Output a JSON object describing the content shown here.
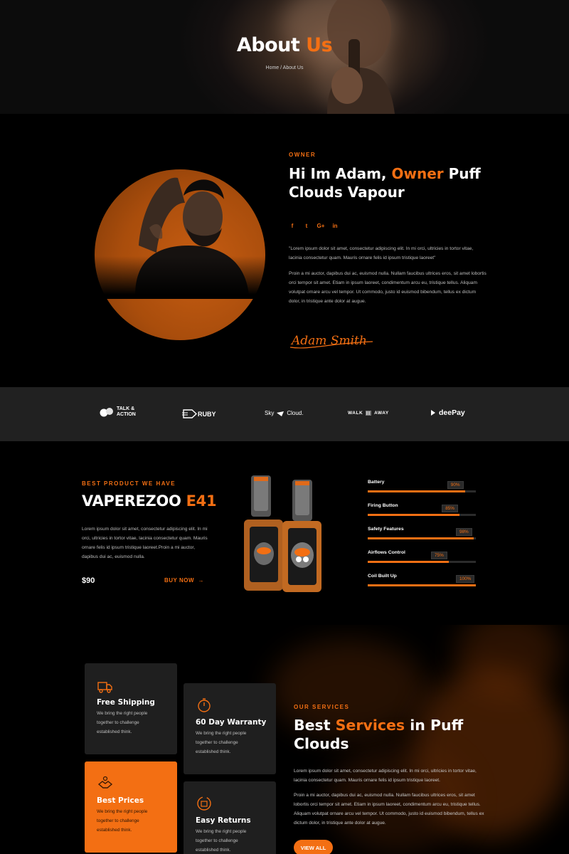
{
  "colors": {
    "accent": "#f36f13",
    "background": "#000000",
    "brand_bar": "#212121",
    "card": "#1f1f1f"
  },
  "hero": {
    "title_white": "About",
    "title_orange": "Us",
    "breadcrumb": "Home / About Us"
  },
  "owner": {
    "label": "OWNER",
    "title_part1": "Hi Im Adam,",
    "title_orange": "Owner",
    "title_part2": "Puff Clouds Vapour",
    "socials": [
      {
        "icon": "facebook-icon",
        "glyph": "f"
      },
      {
        "icon": "twitter-icon",
        "glyph": "t"
      },
      {
        "icon": "google-plus-icon",
        "glyph": "G+"
      },
      {
        "icon": "linkedin-icon",
        "glyph": "in"
      }
    ],
    "quote": "\"Lorem ipsum dolor sit amet, consectetur adipiscing elit. In mi orci, ultricies in tortor vitae, lacinia consectetur quam. Mauris ornare felis id ipsum tristique laoreet\"",
    "body": "Proin a mi auctor, dapibus dui ac, euismod nulla. Nullam faucibus ultrices eros, sit amet lobortis orci tempor sit amet. Etiam in ipsum laoreet, condimentum arcu eu, tristique tellus. Aliquam volutpat ornare arcu vel tempor. Ut commodo, justo id euismod bibendum, tellus ex dictum dolor, in tristique ante dolor at augue.",
    "signature": "Adam Smith"
  },
  "brands": [
    {
      "name": "TALK & ACTION",
      "line1": "TALK &",
      "line2": "ACTION"
    },
    {
      "name": "RUBY"
    },
    {
      "name": "Sky Cloud.",
      "left": "Sky",
      "right": "Cloud."
    },
    {
      "name": "WALK AWAY",
      "left": "WALK",
      "right": "AWAY"
    },
    {
      "name": "deePay"
    }
  ],
  "product": {
    "label": "BEST PRODUCT WE HAVE",
    "title_white": "VAPEREZOO",
    "title_orange": "E41",
    "body": "Lorem ipsum dolor sit amet, consectetur adipiscing elit. In mi orci, ultricies in tortor vitae, lacinia consectetur quam. Mauris ornare felis id ipsum tristique laoreet.Proin a mi auctor, dapibus dui ac, euismod nulla.",
    "price": "$90",
    "buy_label": "BUY NOW",
    "skills": [
      {
        "name": "Battery",
        "percent": 90,
        "label": "90%"
      },
      {
        "name": "Firing Button",
        "percent": 85,
        "label": "85%"
      },
      {
        "name": "Safety Features",
        "percent": 98,
        "label": "98%"
      },
      {
        "name": "Airflows Control",
        "percent": 75,
        "label": "75%"
      },
      {
        "name": "Coil Built Up",
        "percent": 100,
        "label": "100%"
      }
    ]
  },
  "services": {
    "label": "OUR SERVICES",
    "title_part1": "Best",
    "title_orange": "Services",
    "title_part2": "in Puff Clouds",
    "body1": "Lorem ipsum dolor sit amet, consectetur adipiscing elit. In mi orci, ultricies in tortor vitae, lacinia consectetur quam. Mauris ornare felis id ipsum tristique laoreet.",
    "body2": "Proin a mi auctor, dapibus dui ac, euismod nulla. Nullam faucibus ultrices eros, sit amet lobortis orci tempor sit amet. Etiam in ipsum laoreet, condimentum arcu eu, tristique tellus. Aliquam volutpat ornare arcu vel tempor. Ut commodo, justo id euismod bibendum, tellus ex dictum dolor, in tristique ante dolor at augue.",
    "button": "VIEW ALL",
    "cards": [
      {
        "title": "Free Shipping",
        "text": "We bring the right people together to challenge established think.",
        "icon": "truck-icon"
      },
      {
        "title": "60 Day Warranty",
        "text": "We bring the right people together to challenge established think.",
        "icon": "stopwatch-icon"
      },
      {
        "title": "Best Prices",
        "text": "We bring the right people together to challenge established think.",
        "icon": "handshake-icon"
      },
      {
        "title": "Easy Returns",
        "text": "We bring the right people together to challenge established think.",
        "icon": "returns-box-icon"
      }
    ]
  }
}
